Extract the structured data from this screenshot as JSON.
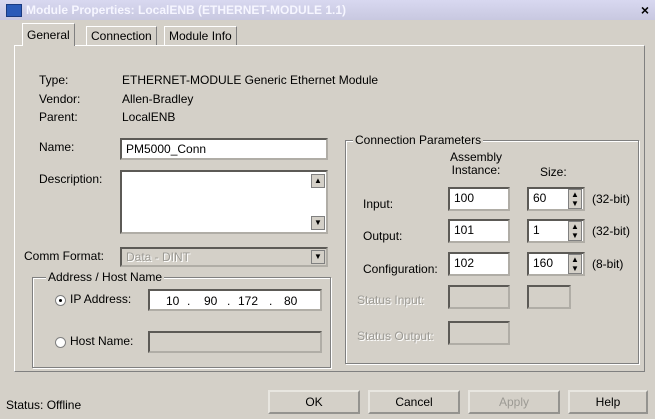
{
  "window": {
    "title": "Module Properties: LocalENB (ETHERNET-MODULE 1.1)",
    "close": "×"
  },
  "tabs": [
    "General",
    "Connection",
    "Module Info"
  ],
  "general": {
    "type_label": "Type:",
    "type_value": "ETHERNET-MODULE Generic Ethernet Module",
    "vendor_label": "Vendor:",
    "vendor_value": "Allen-Bradley",
    "parent_label": "Parent:",
    "parent_value": "LocalENB",
    "name_label": "Name:",
    "name_value": "PM5000_Conn",
    "description_label": "Description:",
    "comm_format_label": "Comm Format:",
    "comm_format_value": "Data - DINT"
  },
  "address": {
    "group_title": "Address / Host Name",
    "ip_label": "IP Address:",
    "ip": [
      "10",
      "90",
      "172",
      "80"
    ],
    "host_label": "Host Name:"
  },
  "connection": {
    "group_title": "Connection Parameters",
    "assembly_header": "Assembly\nInstance:",
    "size_header": "Size:",
    "rows": [
      {
        "label": "Input:",
        "instance": "100",
        "size": "60",
        "unit": "(32-bit)"
      },
      {
        "label": "Output:",
        "instance": "101",
        "size": "1",
        "unit": "(32-bit)"
      },
      {
        "label": "Configuration:",
        "instance": "102",
        "size": "160",
        "unit": "(8-bit)"
      }
    ],
    "status_input_label": "Status Input:",
    "status_output_label": "Status Output:"
  },
  "footer": {
    "status": "Status:  Offline",
    "ok": "OK",
    "cancel": "Cancel",
    "apply": "Apply",
    "help": "Help"
  }
}
